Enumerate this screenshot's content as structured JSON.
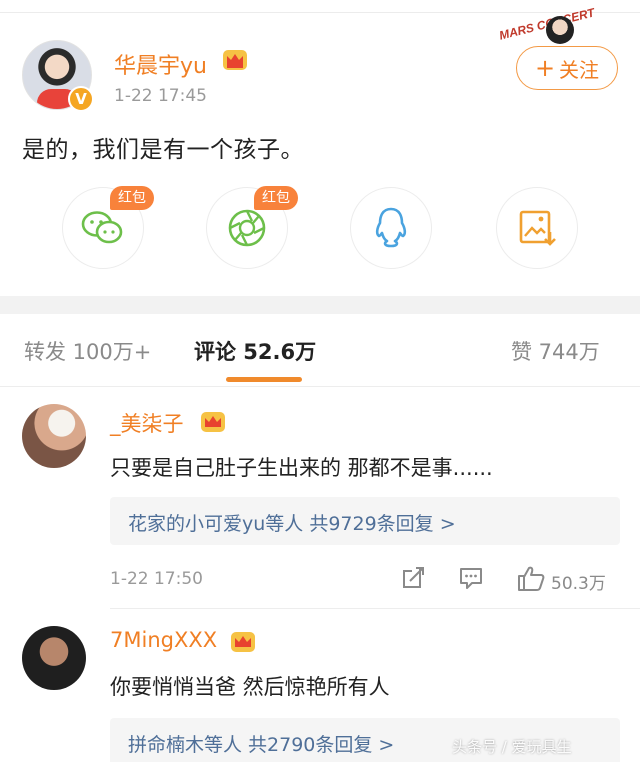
{
  "post": {
    "username": "华晨宇yu",
    "time": "1-22 17:45",
    "text": "是的，我们是有一个孩子。",
    "follow_label": "关注",
    "follow_plus": "+",
    "verified_badge": "V",
    "watermark_logo_text": "MARS CONCERT"
  },
  "share": {
    "redpack_label": "红包",
    "items": [
      {
        "icon": "wechat-icon"
      },
      {
        "icon": "moments-icon"
      },
      {
        "icon": "qq-icon"
      },
      {
        "icon": "save-image-icon"
      }
    ]
  },
  "tabs": {
    "repost": "转发 100万+",
    "comments": "评论 52.6万",
    "likes": "赞 744万"
  },
  "comments": [
    {
      "username": "_美柒子",
      "text": "只要是自己肚子生出来的 那都不是事......",
      "replies": "花家的小可爱yu等人 共9729条回复 >",
      "time": "1-22 17:50",
      "like_count": "50.3万"
    },
    {
      "username": "7MingXXX",
      "text": "你要悄悄当爸 然后惊艳所有人",
      "replies": "拼命楠木等人 共2790条回复 >"
    }
  ],
  "watermark": "头条号 / 爱玩具生",
  "colors": {
    "accent_orange": "#f07f24",
    "link_blue": "#4f6f98",
    "redpack": "#f8823b",
    "icon_green": "#6dbf4a",
    "icon_blue": "#4aa3df",
    "icon_orange": "#f0a030"
  }
}
